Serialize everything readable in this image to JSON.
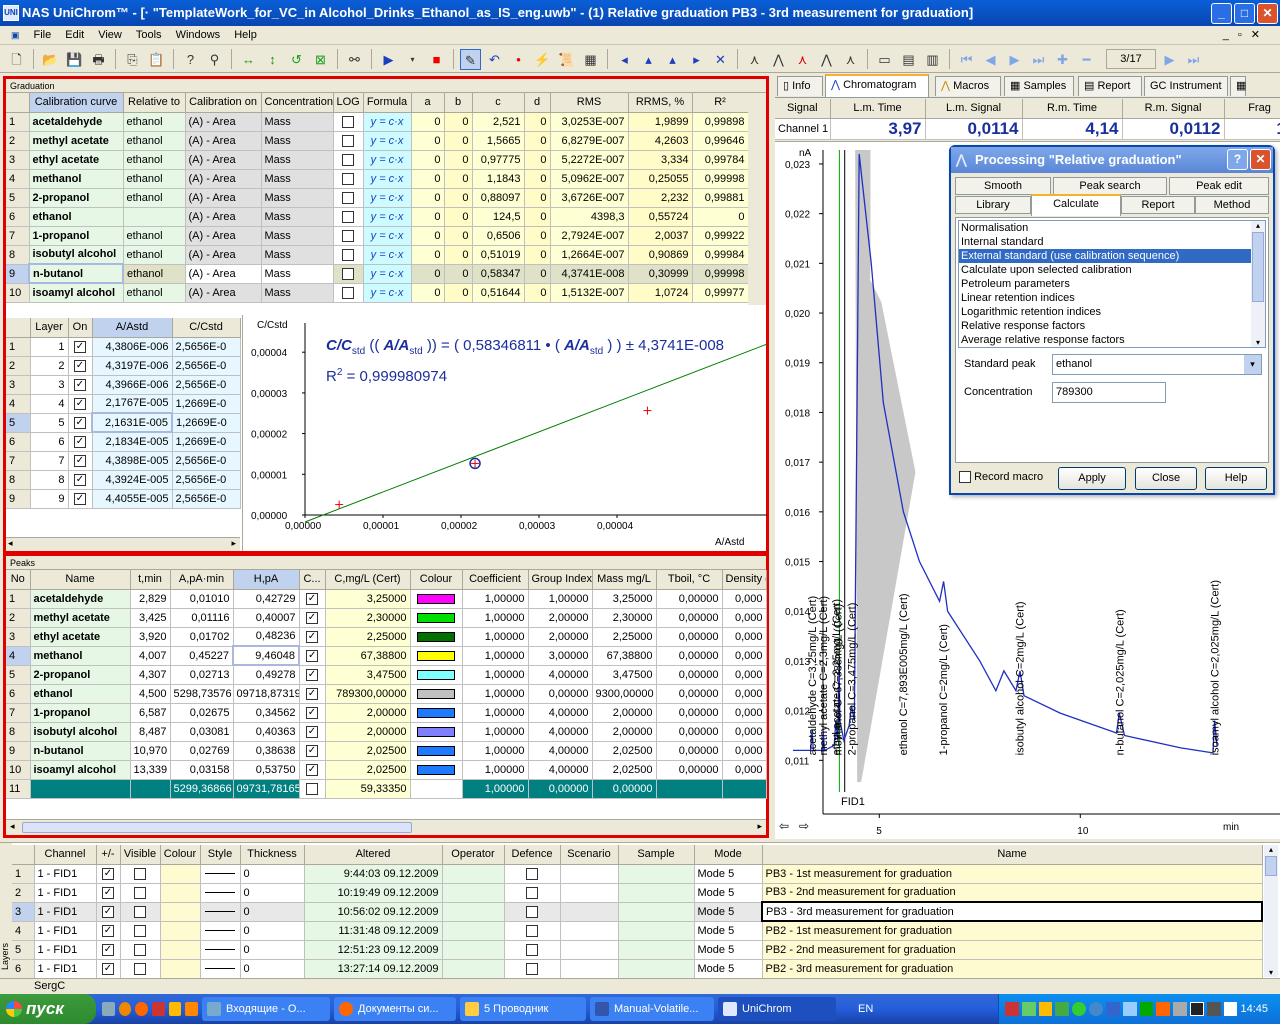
{
  "window": {
    "app": "NAS UniChrom",
    "title_rest": "™ - [· \"TemplateWork_for_VC_in Alcohol_Drinks_Ethanol_as_IS_eng.uwb\" - (1) Relative graduation PB3 - 3rd measurement for graduation]",
    "min": "_",
    "max": "□",
    "close": "✕"
  },
  "menu": [
    "File",
    "Edit",
    "View",
    "Tools",
    "Windows",
    "Help"
  ],
  "toolbar": {
    "page_counter": "3/17"
  },
  "graduation": {
    "panel_title": "Graduation",
    "headers": [
      "",
      "Calibration curve",
      "Relative to",
      "Calibration on",
      "Concentration",
      "LOG",
      "Formula",
      "a",
      "b",
      "c",
      "d",
      "RMS",
      "RRMS, %",
      "R²"
    ],
    "rows": [
      [
        "1",
        "acetaldehyde",
        "ethanol",
        "(A) - Area",
        "Mass",
        "",
        "y = c·x",
        "0",
        "0",
        "2,521",
        "0",
        "3,0253E-007",
        "1,9899",
        "0,99898"
      ],
      [
        "2",
        "methyl acetate",
        "ethanol",
        "(A) - Area",
        "Mass",
        "",
        "y = c·x",
        "0",
        "0",
        "1,5665",
        "0",
        "6,8279E-007",
        "4,2603",
        "0,99646"
      ],
      [
        "3",
        "ethyl acetate",
        "ethanol",
        "(A) - Area",
        "Mass",
        "",
        "y = c·x",
        "0",
        "0",
        "0,97775",
        "0",
        "5,2272E-007",
        "3,334",
        "0,99784"
      ],
      [
        "4",
        "methanol",
        "ethanol",
        "(A) - Area",
        "Mass",
        "",
        "y = c·x",
        "0",
        "0",
        "1,1843",
        "0",
        "5,0962E-007",
        "0,25055",
        "0,99998"
      ],
      [
        "5",
        "2-propanol",
        "ethanol",
        "(A) - Area",
        "Mass",
        "",
        "y = c·x",
        "0",
        "0",
        "0,88097",
        "0",
        "3,6726E-007",
        "2,232",
        "0,99881"
      ],
      [
        "6",
        "ethanol",
        "",
        "(A) - Area",
        "Mass",
        "",
        "y = c·x",
        "0",
        "0",
        "124,5",
        "0",
        "4398,3",
        "0,55724",
        "0"
      ],
      [
        "7",
        "1-propanol",
        "ethanol",
        "(A) - Area",
        "Mass",
        "",
        "y = c·x",
        "0",
        "0",
        "0,6506",
        "0",
        "2,7924E-007",
        "2,0037",
        "0,99922"
      ],
      [
        "8",
        "isobutyl alcohol",
        "ethanol",
        "(A) - Area",
        "Mass",
        "",
        "y = c·x",
        "0",
        "0",
        "0,51019",
        "0",
        "1,2664E-007",
        "0,90869",
        "0,99984"
      ],
      [
        "9",
        "n-butanol",
        "ethanol",
        "(A) - Area",
        "Mass",
        "",
        "y = c·x",
        "0",
        "0",
        "0,58347",
        "0",
        "4,3741E-008",
        "0,30999",
        "0,99998"
      ],
      [
        "10",
        "isoamyl alcohol",
        "ethanol",
        "(A) - Area",
        "Mass",
        "",
        "y = c·x",
        "0",
        "0",
        "0,51644",
        "0",
        "1,5132E-007",
        "1,0724",
        "0,99977"
      ]
    ]
  },
  "layers": {
    "headers": [
      "",
      "Layer",
      "On",
      "A/Astd",
      "C/Cstd"
    ],
    "rows": [
      [
        "1",
        "1",
        "4,3806E-006",
        "2,5656E-0"
      ],
      [
        "2",
        "2",
        "4,3197E-006",
        "2,5656E-0"
      ],
      [
        "3",
        "3",
        "4,3966E-006",
        "2,5656E-0"
      ],
      [
        "4",
        "4",
        "2,1767E-005",
        "1,2669E-0"
      ],
      [
        "5",
        "5",
        "2,1631E-005",
        "1,2669E-0"
      ],
      [
        "6",
        "6",
        "2,1834E-005",
        "1,2669E-0"
      ],
      [
        "7",
        "7",
        "4,3898E-005",
        "2,5656E-0"
      ],
      [
        "8",
        "8",
        "4,3924E-005",
        "2,5656E-0"
      ],
      [
        "9",
        "9",
        "4,4055E-005",
        "2,5656E-0"
      ]
    ]
  },
  "calplot": {
    "ylabel": "C/Cstd",
    "xlabel": "A/Astd",
    "eq_c": "C/C",
    "eq_std": "std",
    "eq_mid": " (( ",
    "eq_aa": "A/A",
    "eq_close": " )) = ( 0,58346811 • ( ",
    "eq_end": " ) ) ± 4,3741E-008",
    "r2_label": "R",
    "r2_sup": "2",
    "r2_value": " = 0,999980974",
    "yticks": [
      "0,00004",
      "0,00003",
      "0,00002",
      "0,00001",
      "0,00000"
    ],
    "xticks": [
      "0,00000",
      "0,00001",
      "0,00002",
      "0,00003",
      "0,00004"
    ]
  },
  "peaks": {
    "panel_title": "Peaks",
    "headers": [
      "No",
      "Name",
      "t,min",
      "A,pA·min",
      "H,pA",
      "C...",
      "C,mg/L (Cert)",
      "Colour",
      "Coefficient",
      "Group Index",
      "Mass mg/L",
      "Tboil, °C",
      "Density g"
    ],
    "rows": [
      [
        "1",
        "acetaldehyde",
        "2,829",
        "0,01010",
        "0,42729",
        "3,25000",
        "#ff00ff",
        "1,00000",
        "1,00000",
        "3,25000",
        "0,00000",
        "0,000"
      ],
      [
        "2",
        "methyl acetate",
        "3,425",
        "0,01116",
        "0,40007",
        "2,30000",
        "#00e000",
        "1,00000",
        "2,00000",
        "2,30000",
        "0,00000",
        "0,000"
      ],
      [
        "3",
        "ethyl acetate",
        "3,920",
        "0,01702",
        "0,48236",
        "2,25000",
        "#007000",
        "1,00000",
        "2,00000",
        "2,25000",
        "0,00000",
        "0,000"
      ],
      [
        "4",
        "methanol",
        "4,007",
        "0,45227",
        "9,46048",
        "67,38800",
        "#ffff00",
        "1,00000",
        "3,00000",
        "67,38800",
        "0,00000",
        "0,000"
      ],
      [
        "5",
        "2-propanol",
        "4,307",
        "0,02713",
        "0,49278",
        "3,47500",
        "#80ffff",
        "1,00000",
        "4,00000",
        "3,47500",
        "0,00000",
        "0,000"
      ],
      [
        "6",
        "ethanol",
        "4,500",
        "5298,73576",
        "09718,87319",
        "789300,00000",
        "#c0c0c0",
        "1,00000",
        "0,00000",
        "9300,00000",
        "0,00000",
        "0,000"
      ],
      [
        "7",
        "1-propanol",
        "6,587",
        "0,02675",
        "0,34562",
        "2,00000",
        "#1e7aff",
        "1,00000",
        "4,00000",
        "2,00000",
        "0,00000",
        "0,000"
      ],
      [
        "8",
        "isobutyl alcohol",
        "8,487",
        "0,03081",
        "0,40363",
        "2,00000",
        "#8080ff",
        "1,00000",
        "4,00000",
        "2,00000",
        "0,00000",
        "0,000"
      ],
      [
        "9",
        "n-butanol",
        "10,970",
        "0,02769",
        "0,38638",
        "2,02500",
        "#1e7aff",
        "1,00000",
        "4,00000",
        "2,02500",
        "0,00000",
        "0,000"
      ],
      [
        "10",
        "isoamyl alcohol",
        "13,339",
        "0,03158",
        "0,53750",
        "2,02500",
        "#1e7aff",
        "1,00000",
        "4,00000",
        "2,02500",
        "0,00000",
        "0,000"
      ]
    ],
    "total": [
      "11",
      "",
      "",
      "5299,36866",
      "09731,78165",
      "59,33350",
      "",
      "1,00000",
      "0,00000",
      "0,00000",
      "",
      ""
    ]
  },
  "right_tabs": [
    "Info",
    "Chromatogram",
    "Macros",
    "Samples",
    "Report",
    "GC Instrument"
  ],
  "signal_header": [
    "Signal",
    "L.m. Time",
    "L.m. Signal",
    "R.m. Time",
    "R.m. Signal",
    "Frag"
  ],
  "signal_row": [
    "Channel 1",
    "3,97",
    "0,0114",
    "4,14",
    "0,0112",
    "1("
  ],
  "chrom": {
    "yunit": "nA",
    "xunit": "min",
    "channel": "FID1",
    "yticks": [
      "0,023",
      "0,022",
      "0,021",
      "0,020",
      "0,019",
      "0,018",
      "0,017",
      "0,016",
      "0,015",
      "0,014",
      "0,013",
      "0,012",
      "0,011"
    ],
    "xticks": [
      "5",
      "10"
    ],
    "labels": [
      "acetaldehyde C=3,25mg/L (Cert)",
      "methyl acetate C=2,3mg/L (Cert)",
      "ethyl acetate C=2,25mg/L (Cert)",
      "2-propanol C=3,475mg/L (Cert)",
      "methanol C=67,388mg/L (Cert)",
      "ethanol C=7,893E005mg/L (Cert)",
      "1-propanol C=2mg/L (Cert)",
      "isobutyl alcohol C=2mg/L (Cert)",
      "n-butanol C=2,025mg/L (Cert)",
      "isoamyl alcohol C=2,025mg/L (Cert)"
    ]
  },
  "dialog": {
    "title": "Processing \"Relative graduation\"",
    "help": "?",
    "close": "✕",
    "tabs_row1": [
      "Smooth",
      "Peak search",
      "Peak edit"
    ],
    "tabs_row2": [
      "Library",
      "Calculate",
      "Report",
      "Method"
    ],
    "list": [
      "Normalisation",
      "Internal standard",
      "External standard (use calibration sequence)",
      "Calculate upon selected calibration",
      "Petroleum parameters",
      "Linear retention indices",
      "Logarithmic retention indices",
      "Relative response factors",
      "Average relative response factors"
    ],
    "std_label": "Standard peak",
    "std_value": "ethanol",
    "conc_label": "Concentration",
    "conc_value": "789300",
    "macro": "Record macro",
    "apply": "Apply",
    "close_btn": "Close",
    "help_btn": "Help"
  },
  "bottom": {
    "side_label": "Layers",
    "headers": [
      "",
      "Channel",
      "+/-",
      "Visible",
      "Colour",
      "Style",
      "Thickness",
      "Altered",
      "Operator",
      "Defence",
      "Scenario",
      "Sample",
      "Mode",
      "Name"
    ],
    "rows": [
      [
        "1",
        "1 - FID1",
        "0",
        "9:44:03 09.12.2009",
        "Mode 5",
        "PB3 - 1st measurement for graduation"
      ],
      [
        "2",
        "1 - FID1",
        "0",
        "10:19:49 09.12.2009",
        "Mode 5",
        "PB3 - 2nd measurement for graduation"
      ],
      [
        "3",
        "1 - FID1",
        "0",
        "10:56:02 09.12.2009",
        "Mode 5",
        "PB3 - 3rd measurement for graduation"
      ],
      [
        "4",
        "1 - FID1",
        "0",
        "11:31:48 09.12.2009",
        "Mode 5",
        "PB2 - 1st measurement for graduation"
      ],
      [
        "5",
        "1 - FID1",
        "0",
        "12:51:23 09.12.2009",
        "Mode 5",
        "PB2 - 2nd measurement for graduation"
      ],
      [
        "6",
        "1 - FID1",
        "0",
        "13:27:14 09.12.2009",
        "Mode 5",
        "PB2 - 3rd measurement for graduation"
      ]
    ]
  },
  "status": {
    "user": "SergC"
  },
  "taskbar": {
    "start": "пуск",
    "tasks": [
      "Входящие - О...",
      "Документы си...",
      "5 Проводник",
      "Manual-Volatile...",
      "UniChrom"
    ],
    "lang": "EN",
    "clock": "14:45"
  }
}
